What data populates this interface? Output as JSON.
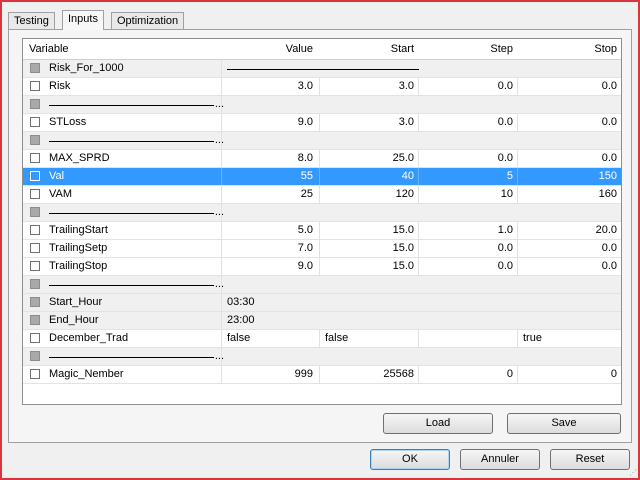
{
  "tabs": [
    {
      "label": "Testing"
    },
    {
      "label": "Inputs"
    },
    {
      "label": "Optimization"
    }
  ],
  "columns": {
    "variable": "Variable",
    "value": "Value",
    "start": "Start",
    "step": "Step",
    "stop": "Stop"
  },
  "rows": [
    {
      "variable": "Risk_For_1000",
      "value": "",
      "start": "",
      "step": "",
      "stop": ""
    },
    {
      "variable": "Risk",
      "value": "3.0",
      "start": "3.0",
      "step": "0.0",
      "stop": "0.0"
    },
    {
      "variable": "...",
      "value": "",
      "start": "",
      "step": "",
      "stop": ""
    },
    {
      "variable": "STLoss",
      "value": "9.0",
      "start": "3.0",
      "step": "0.0",
      "stop": "0.0"
    },
    {
      "variable": "...",
      "value": "",
      "start": "",
      "step": "",
      "stop": ""
    },
    {
      "variable": "MAX_SPRD",
      "value": "8.0",
      "start": "25.0",
      "step": "0.0",
      "stop": "0.0"
    },
    {
      "variable": "Val",
      "value": "55",
      "start": "40",
      "step": "5",
      "stop": "150"
    },
    {
      "variable": "VAM",
      "value": "25",
      "start": "120",
      "step": "10",
      "stop": "160"
    },
    {
      "variable": "...",
      "value": "",
      "start": "",
      "step": "",
      "stop": ""
    },
    {
      "variable": "TrailingStart",
      "value": "5.0",
      "start": "15.0",
      "step": "1.0",
      "stop": "20.0"
    },
    {
      "variable": "TrailingSetp",
      "value": "7.0",
      "start": "15.0",
      "step": "0.0",
      "stop": "0.0"
    },
    {
      "variable": "TrailingStop",
      "value": "9.0",
      "start": "15.0",
      "step": "0.0",
      "stop": "0.0"
    },
    {
      "variable": "...",
      "value": "",
      "start": "",
      "step": "",
      "stop": ""
    },
    {
      "variable": "Start_Hour",
      "value": "03:30",
      "start": "",
      "step": "",
      "stop": ""
    },
    {
      "variable": "End_Hour",
      "value": "23:00",
      "start": "",
      "step": "",
      "stop": ""
    },
    {
      "variable": "December_Trad",
      "value": "false",
      "start": "false",
      "step": "",
      "stop": "true"
    },
    {
      "variable": "...",
      "value": "",
      "start": "",
      "step": "",
      "stop": ""
    },
    {
      "variable": "Magic_Nember",
      "value": "999",
      "start": "25568",
      "step": "0",
      "stop": "0"
    }
  ],
  "buttons": {
    "load": "Load",
    "save": "Save",
    "ok": "OK",
    "cancel": "Annuler",
    "reset": "Reset"
  },
  "colors": {
    "selection": "#3399ff",
    "frame_border": "#d9363b"
  }
}
